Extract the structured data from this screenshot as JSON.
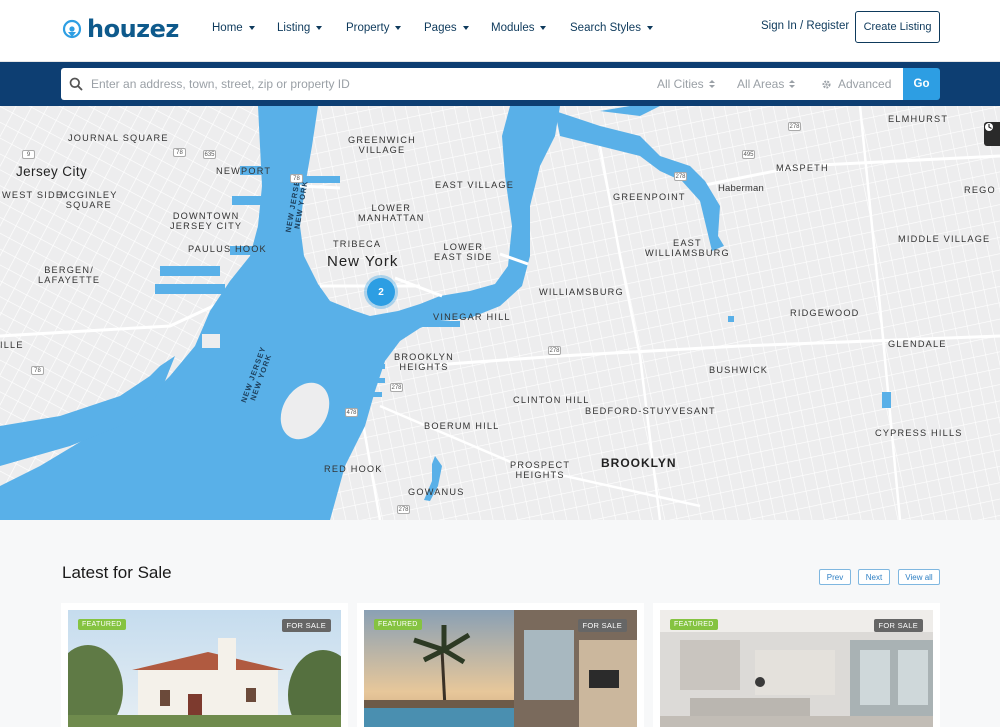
{
  "header": {
    "logo_text": "houzez",
    "nav": [
      {
        "label": "Home"
      },
      {
        "label": "Listing"
      },
      {
        "label": "Property"
      },
      {
        "label": "Pages"
      },
      {
        "label": "Modules"
      },
      {
        "label": "Search Styles"
      }
    ],
    "signin_label": "Sign In / Register",
    "create_label": "Create Listing"
  },
  "search": {
    "placeholder": "Enter an address, town, street, zip or property ID",
    "cities": "All Cities",
    "areas": "All Areas",
    "advanced": "Advanced",
    "go": "Go"
  },
  "map": {
    "cluster_count": "2",
    "labels": {
      "journal_square": "JOURNAL SQUARE",
      "jersey_city": "Jersey City",
      "west_side": "WEST SIDE",
      "mcginley": "MCGINLEY\nSQUARE",
      "newport": "NEWPORT",
      "downtown_jc": "DOWNTOWN\nJERSEY CITY",
      "paulus_hook": "PAULUS HOOK",
      "bergen": "BERGEN/\nLAFAYETTE",
      "ille": "ILLE",
      "greenwich": "GREENWICH\nVILLAGE",
      "east_village": "EAST VILLAGE",
      "lower_manhattan": "LOWER\nMANHATTAN",
      "tribeca": "TRIBECA",
      "new_york": "New York",
      "lower_east_side": "LOWER\nEAST SIDE",
      "vinegar_hill": "VINEGAR HILL",
      "brooklyn_heights": "BROOKLYN\nHEIGHTS",
      "clinton_hill": "CLINTON HILL",
      "boerum_hill": "BOERUM HILL",
      "red_hook": "RED HOOK",
      "gowanus": "GOWANUS",
      "prospect_heights": "PROSPECT\nHEIGHTS",
      "brooklyn": "BROOKLYN",
      "bedford": "BEDFORD-STUYVESANT",
      "williamsburg": "WILLIAMSBURG",
      "east_williamsburg": "EAST\nWILLIAMSBURG",
      "greenpoint": "GREENPOINT",
      "haberman": "Haberman",
      "maspeth": "MASPETH",
      "elmhurst": "ELMHURST",
      "rego": "REGO P",
      "middle_village": "MIDDLE VILLAGE",
      "ridgewood": "RIDGEWOOD",
      "glendale": "GLENDALE",
      "bushwick": "BUSHWICK",
      "cypress_hills": "CYPRESS HILLS",
      "water_nj1": "NEW JERSEY\nNEW YORK",
      "water_nj2": "NEW JERSEY\nNEW YORK"
    },
    "shields": [
      "78",
      "9",
      "635",
      "78",
      "278",
      "495",
      "278",
      "278",
      "278",
      "78",
      "478",
      "278"
    ]
  },
  "listings": {
    "title": "Latest for Sale",
    "prev": "Prev",
    "next": "Next",
    "view_all": "View all",
    "cards": [
      {
        "featured": "FEATURED",
        "status": "FOR SALE"
      },
      {
        "featured": "FEATURED",
        "status": "FOR SALE"
      },
      {
        "featured": "FEATURED",
        "status": "FOR SALE"
      }
    ]
  },
  "colors": {
    "brand": "#0e5a8c",
    "search_band": "#0d3e72",
    "accent": "#2d9ee3",
    "water": "#59b0e8",
    "featured": "#85c341"
  }
}
